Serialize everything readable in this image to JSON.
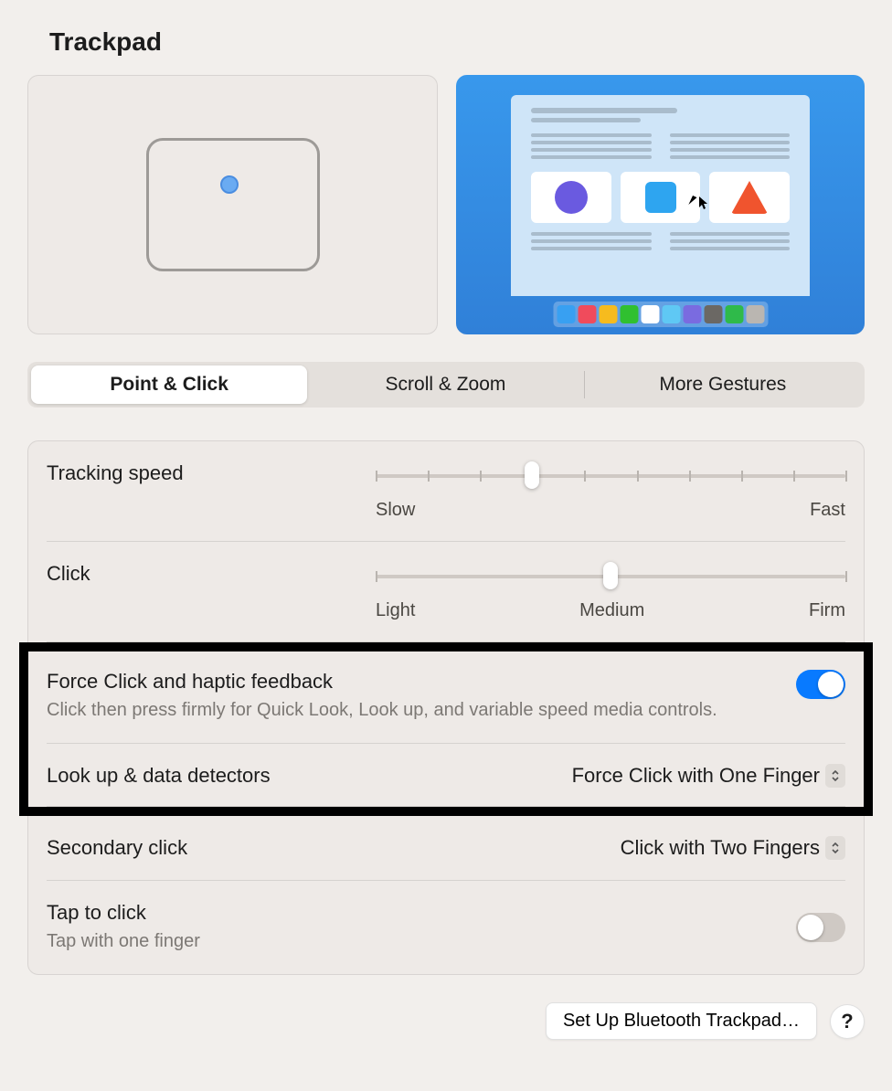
{
  "header": {
    "title": "Trackpad"
  },
  "tabs": [
    {
      "label": "Point & Click",
      "active": true
    },
    {
      "label": "Scroll & Zoom",
      "active": false
    },
    {
      "label": "More Gestures",
      "active": false
    }
  ],
  "tracking_speed": {
    "label": "Tracking speed",
    "min_label": "Slow",
    "max_label": "Fast",
    "ticks": 10,
    "value_index": 3
  },
  "click": {
    "label": "Click",
    "min_label": "Light",
    "mid_label": "Medium",
    "max_label": "Firm",
    "ticks": 3,
    "value_index": 1
  },
  "force_click": {
    "label": "Force Click and haptic feedback",
    "description": "Click then press firmly for Quick Look, Look up, and variable speed media controls.",
    "enabled": true
  },
  "lookup": {
    "label": "Look up & data detectors",
    "selected": "Force Click with One Finger"
  },
  "secondary_click": {
    "label": "Secondary click",
    "selected": "Click with Two Fingers"
  },
  "tap_to_click": {
    "label": "Tap to click",
    "description": "Tap with one finger",
    "enabled": false
  },
  "footer": {
    "bluetooth_button": "Set Up Bluetooth Trackpad…",
    "help": "?"
  },
  "dock_colors": [
    "#38a0f2",
    "#f04b5c",
    "#f6bb1e",
    "#30c030",
    "#ffffff",
    "#5fc8f4",
    "#7a6be0",
    "#6b6864",
    "#2fba4a",
    "#bab6b1"
  ]
}
